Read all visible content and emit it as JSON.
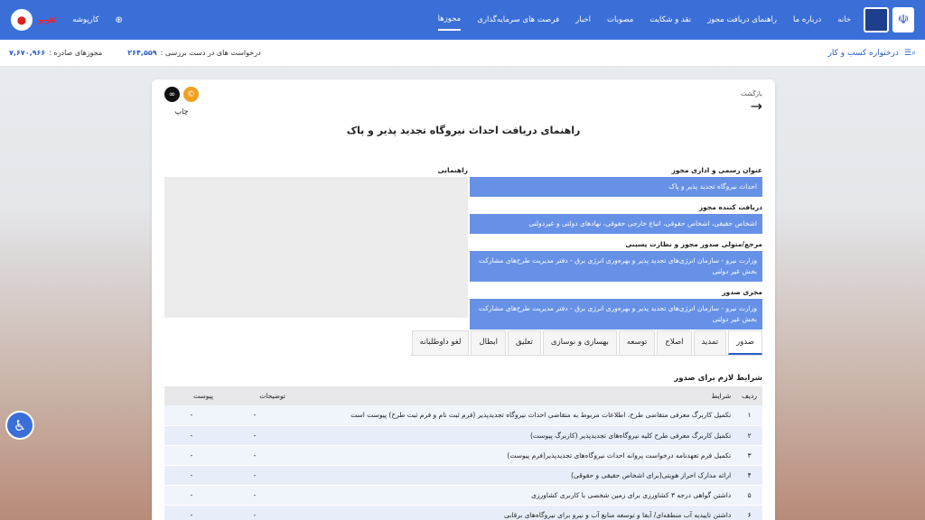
{
  "nav": {
    "items": [
      "خانه",
      "درباره ما",
      "راهنمای دریافت مجوز",
      "نقد و شکایت",
      "مصوبات",
      "اخبار",
      "فرصت های سرمایه‌گذاری",
      "مجوزها"
    ],
    "language": "کارپوشه",
    "user_name": "کاربر"
  },
  "subbar": {
    "title": "درختواره کسب و کار",
    "pending_label": "درخواست های در دست بررسی :",
    "pending_value": "۲۶۴,۵۵۹",
    "issued_label": "مجوزهای صادره :",
    "issued_value": "۷,۶۷۰,۹۶۶"
  },
  "card": {
    "back_label": "بازگشت",
    "print_label": "چاپ",
    "title": "راهنمای دریافت احداث نیروگاه تجدید پذیر و پاک",
    "guide_label": "راهنمایی",
    "fields": [
      {
        "label": "عنوان رسمی و اداری مجوز",
        "value": "احداث نیروگاه تجدید پذیر و پاک"
      },
      {
        "label": "دریافت کننده مجوز",
        "value": "اشخاص حقیقی، اشخاص حقوقی، اتباع خارجی حقوقی، نهادهای دولتی و غیردولتی"
      },
      {
        "label": "مرجع/متولی صدور مجوز و نظارت پسینی",
        "value": "وزارت نیرو - سازمان انرژی‌های تجدید پذیر و بهره‌وری انرژی برق - دفتر مدیریت طرح‌های مشارکت بخش غیر دولتی"
      },
      {
        "label": "مجری صدور",
        "value": "وزارت نیرو - سازمان انرژی‌های تجدید پذیر و بهره‌وری انرژی برق - دفتر مدیریت طرح‌های مشارکت بخش غیر دولتی"
      }
    ],
    "tabs": [
      "صدور",
      "تمدید",
      "اصلاح",
      "توسعه",
      "بهسازی و نوسازی",
      "تعلیق",
      "ابطال",
      "لغو داوطلبانه"
    ],
    "section_title": "شرایط لازم برای صدور",
    "table_headers": {
      "num": "ردیف",
      "condition": "شرایط",
      "desc": "توضیحات",
      "attachment": "پیوست"
    },
    "rows": [
      {
        "num": "۱",
        "condition": "تکمیل کاربرگ معرفی متقاضی طرح، اطلاعات مربوط به متقاضی احداث نیروگاه تجدیدپذیر (فرم ثبت نام و فرم ثبت طرح) پیوست است",
        "desc": "-",
        "attachment": "-"
      },
      {
        "num": "۲",
        "condition": "تکمیل کاربرگ معرفی طرح کلیه نیروگاه‌های تجدیدپذیر (کاربرگ پیوست)",
        "desc": "-",
        "attachment": "-"
      },
      {
        "num": "۳",
        "condition": "تکمیل فرم تعهدنامه درخواست پروانه احداث نیروگاه‌های تجدیدپذیر(فرم پیوست)",
        "desc": "-",
        "attachment": "-"
      },
      {
        "num": "۴",
        "condition": "ارائه مدارک احراز هویتی(برای اشخاص حقیقی و حقوقی)",
        "desc": "-",
        "attachment": "-"
      },
      {
        "num": "۵",
        "condition": "داشتن گواهی درجه ۳ کشاورزی برای زمین شخصی با کاربری کشاورزی",
        "desc": "-",
        "attachment": "-"
      },
      {
        "num": "۶",
        "condition": "داشتن تاییدیه آب منطقه‌ای/ آبفا و توسعه منابع آب و نیرو برای نیروگاه‌های برقابی",
        "desc": "-",
        "attachment": "-"
      }
    ]
  }
}
